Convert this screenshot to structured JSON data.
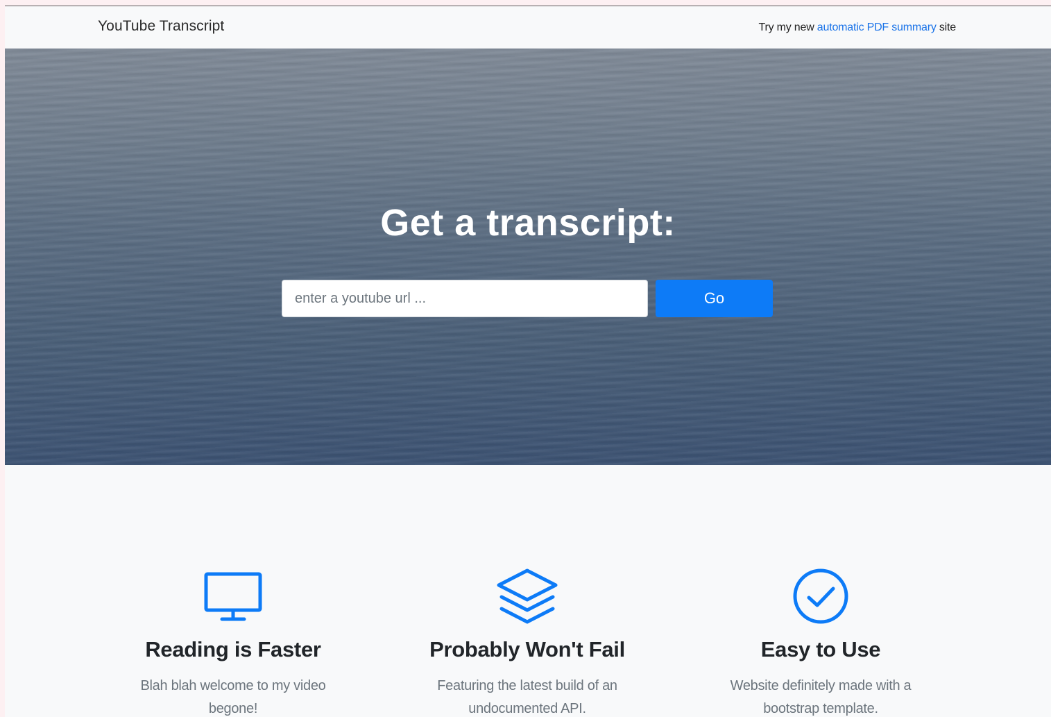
{
  "navbar": {
    "brand": "YouTube Transcript",
    "promo_prefix": "Try my new ",
    "promo_link": "automatic PDF summary",
    "promo_suffix": " site"
  },
  "hero": {
    "title": "Get a transcript:",
    "input_placeholder": "enter a youtube url ...",
    "input_value": "",
    "go_label": "Go"
  },
  "features": [
    {
      "icon": "monitor-icon",
      "title": "Reading is Faster",
      "line1": "Blah blah welcome to my video",
      "line2": "begone!"
    },
    {
      "icon": "layers-icon",
      "title": "Probably Won't Fail",
      "line1": "Featuring the latest build of an",
      "line2": "undocumented API."
    },
    {
      "icon": "check-circle-icon",
      "title": "Easy to Use",
      "line1": "Website definitely made with a",
      "line2": "bootstrap template."
    }
  ],
  "colors": {
    "accent": "#0d7bf7",
    "link": "#1a73e8",
    "heading": "#212529",
    "muted": "#6c757d"
  }
}
